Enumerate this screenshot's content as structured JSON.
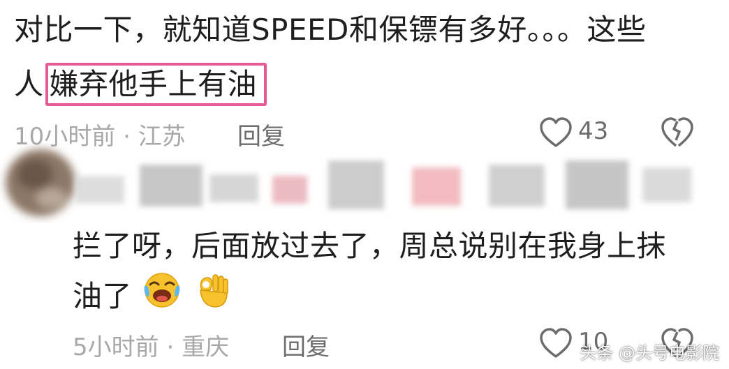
{
  "comments": [
    {
      "text_line1": "对比一下，就知道SPEED和保镖有多好。。。这些",
      "text_line2_prefix": "人",
      "text_line2_highlight": "嫌弃他手上有油",
      "time": "10小时前",
      "separator": "·",
      "location": "江苏",
      "reply_label": "回复",
      "like_count": "43"
    },
    {
      "text_line1": "拦了呀，后面放过去了，周总说别在我身上抹",
      "text_line2": "油了",
      "time": "5小时前",
      "separator": "·",
      "location": "重庆",
      "reply_label": "回复",
      "like_count": "10"
    }
  ],
  "icons": {
    "like": "heart-outline-icon",
    "dislike": "broken-heart-icon",
    "emoji_1": "laughing-crying-emoji-icon",
    "emoji_2": "ok-hand-emoji-icon"
  },
  "colors": {
    "highlight_border": "#e45b97",
    "meta_text": "#a8a8a8",
    "action_text": "#6c6c6c"
  },
  "watermark": "头条 @头号电影院"
}
